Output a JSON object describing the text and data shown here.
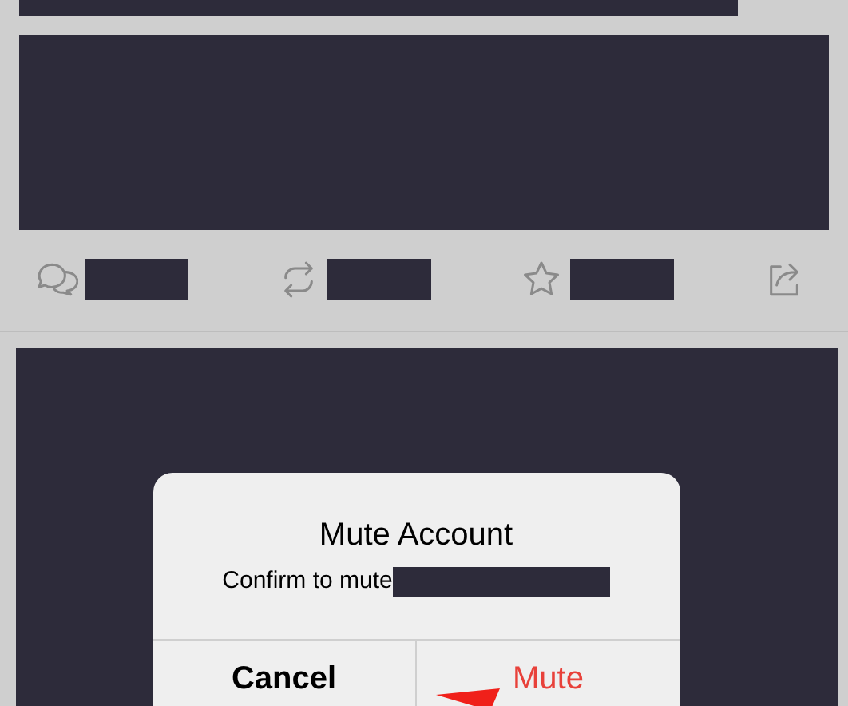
{
  "dialog": {
    "title": "Mute Account",
    "message": "Confirm to mute",
    "buttons": [
      {
        "label": "Cancel",
        "kind": "cancel"
      },
      {
        "label": "Mute",
        "kind": "destructive"
      }
    ]
  }
}
